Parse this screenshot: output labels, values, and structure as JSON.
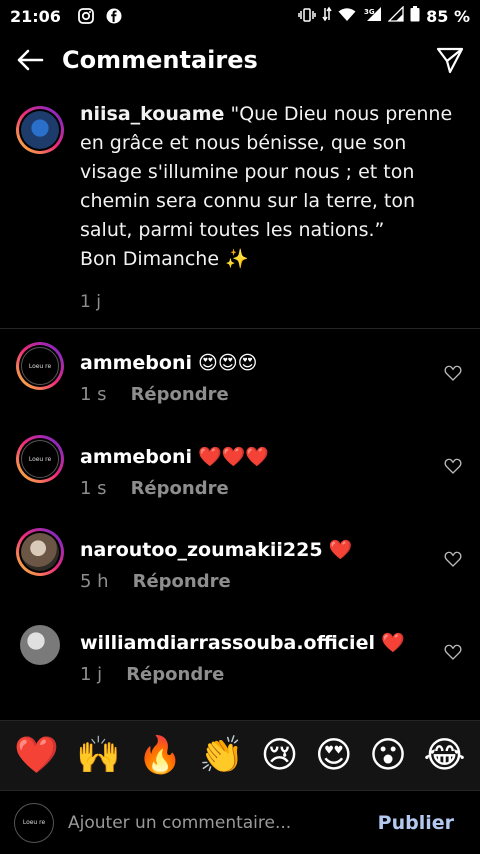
{
  "status": {
    "time": "21:06",
    "battery": "85 %",
    "network": "3G"
  },
  "header": {
    "title": "Commentaires"
  },
  "caption": {
    "username": "niisa_kouame",
    "text": "\"Que Dieu nous prenne en grâce et nous bénisse, que son visage s'illumine pour nous ; et ton chemin sera connu sur la terre, ton salut, parmi toutes les nations.”",
    "line2": "Bon Dimanche ✨",
    "time": "1 j"
  },
  "comments": [
    {
      "username": "ammeboni",
      "text": "😍😍😍",
      "time": "1 s",
      "reply": "Répondre"
    },
    {
      "username": "ammeboni",
      "text": "❤️❤️❤️",
      "time": "1 s",
      "reply": "Répondre"
    },
    {
      "username": "naroutoo_zoumakii225",
      "text": "❤️",
      "time": "5 h",
      "reply": "Répondre"
    },
    {
      "username": "williamdiarrassouba.officiel",
      "text": "❤️",
      "time": "1 j",
      "reply": "Répondre"
    }
  ],
  "emojis": [
    "❤️",
    "🙌",
    "🔥",
    "👏",
    "😢",
    "😍",
    "😮",
    "😂"
  ],
  "input": {
    "placeholder": "Ajouter un commentaire...",
    "publish": "Publier"
  },
  "logo_text": "Loeu re"
}
